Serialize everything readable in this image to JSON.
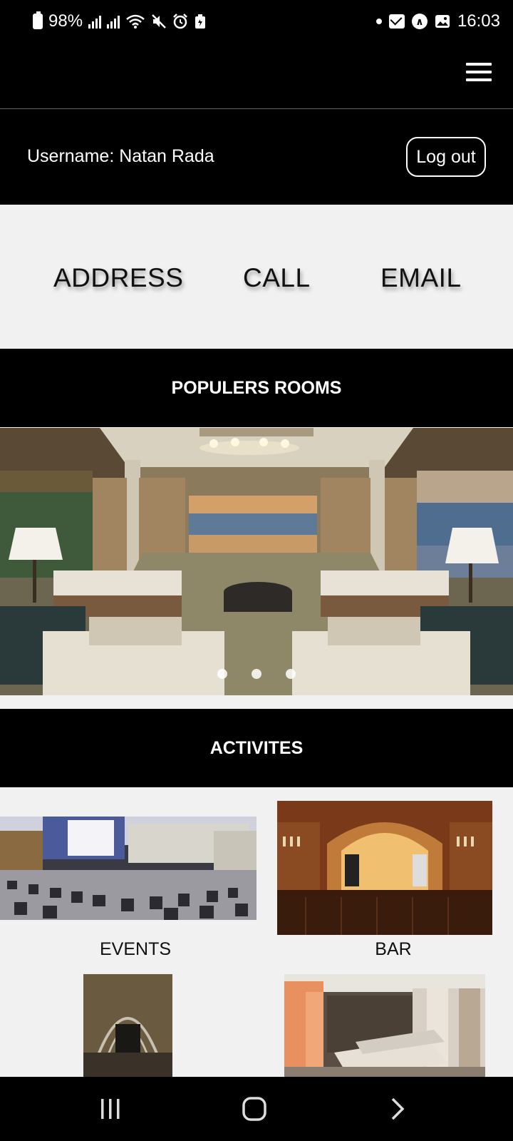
{
  "status_bar": {
    "battery": "98%",
    "time": "16:03"
  },
  "user_bar": {
    "username": "Username: Natan Rada",
    "logout_label": "Log out"
  },
  "contact": {
    "address_label": "ADDRESS",
    "call_label": "CALL",
    "email_label": "EMAIL"
  },
  "popular_rooms": {
    "title": "POPULERS ROOMS",
    "slide_count": 3,
    "active_slide": 2
  },
  "activities": {
    "title": "ACTIVITES",
    "items": [
      {
        "label": "EVENTS"
      },
      {
        "label": "BAR"
      },
      {
        "label": ""
      },
      {
        "label": ""
      }
    ]
  },
  "colors": {
    "header_bg": "#000000",
    "page_bg": "#f1f1f1",
    "text_light": "#ffffff"
  }
}
